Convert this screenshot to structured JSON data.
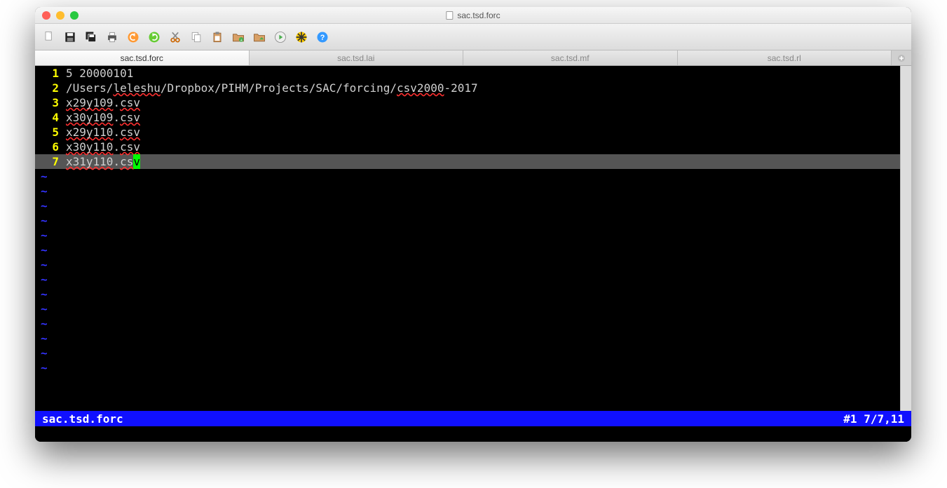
{
  "window": {
    "title": "sac.tsd.forc"
  },
  "toolbar": {
    "icons": [
      "new-file-icon",
      "save-icon",
      "save-all-icon",
      "print-icon",
      "undo-icon",
      "redo-icon",
      "cut-icon",
      "copy-icon",
      "paste-icon",
      "folder-open-icon",
      "folder-new-icon",
      "run-icon",
      "build-icon",
      "help-icon"
    ]
  },
  "tabs": [
    {
      "label": "sac.tsd.forc",
      "active": true
    },
    {
      "label": "sac.tsd.lai",
      "active": false
    },
    {
      "label": "sac.tsd.mf",
      "active": false
    },
    {
      "label": "sac.tsd.rl",
      "active": false
    }
  ],
  "editor": {
    "lines": [
      {
        "num": "1",
        "text": "5 20000101",
        "squiggles": []
      },
      {
        "num": "2",
        "text": "/Users/leleshu/Dropbox/PIHM/Projects/SAC/forcing/csv2000-2017",
        "squiggles": [
          "leleshu",
          "csv2000"
        ]
      },
      {
        "num": "3",
        "text": "x29y109.csv",
        "squiggles": [
          "x29y109",
          "csv"
        ]
      },
      {
        "num": "4",
        "text": "x30y109.csv",
        "squiggles": [
          "x30y109",
          "csv"
        ]
      },
      {
        "num": "5",
        "text": "x29y110.csv",
        "squiggles": [
          "x29y110",
          "csv"
        ]
      },
      {
        "num": "6",
        "text": "x30y110.csv",
        "squiggles": [
          "x30y110",
          "csv"
        ]
      },
      {
        "num": "7",
        "text": "x31y110.csv",
        "squiggles": [
          "x31y110",
          "cs"
        ],
        "current": true,
        "cursorAt": "v"
      }
    ],
    "tilde_count": 14
  },
  "status": {
    "left": "sac.tsd.forc",
    "right": "#1 7/7,11"
  }
}
